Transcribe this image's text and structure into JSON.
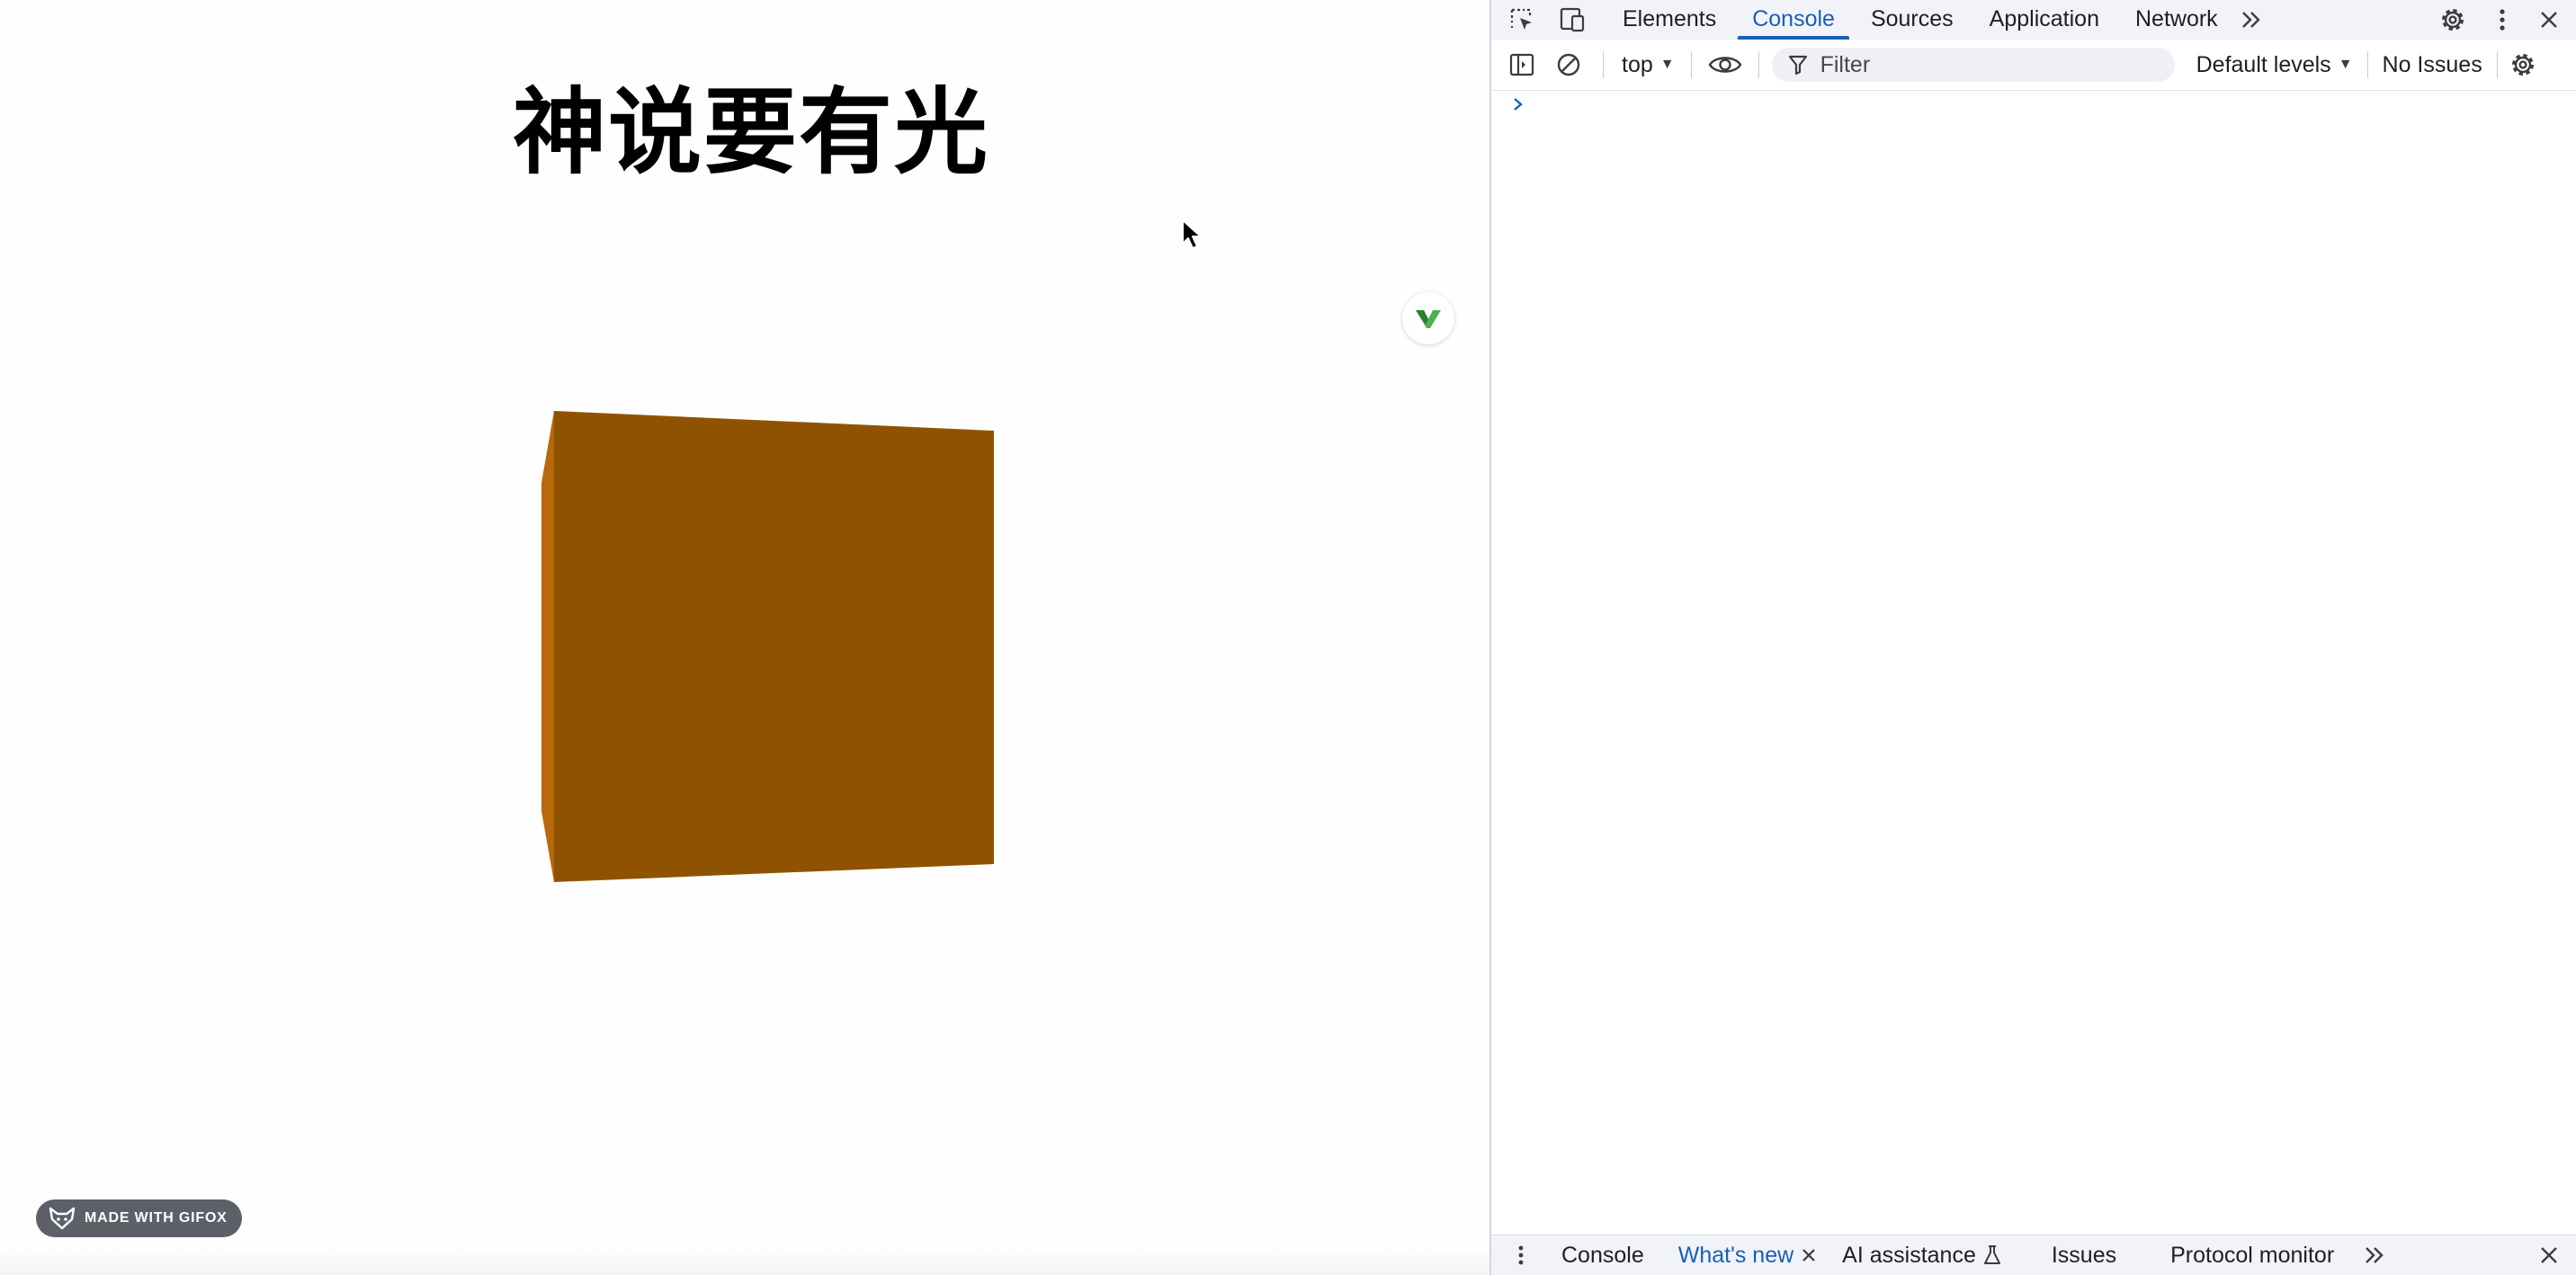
{
  "page": {
    "heading": "神说要有光",
    "badge_icon": "extension-logo-icon",
    "cube_colors": {
      "front": "#8f5300",
      "side": "#b7690c"
    },
    "watermark": "MADE WITH GIFOX"
  },
  "devtools": {
    "tabs": [
      "Elements",
      "Console",
      "Sources",
      "Application",
      "Network"
    ],
    "active_tab": "Console",
    "toolbar": {
      "context": "top",
      "filter_placeholder": "Filter",
      "levels": "Default levels",
      "issues": "No Issues"
    },
    "drawer": {
      "tabs": [
        "Console",
        "What's new",
        "AI assistance",
        "Issues",
        "Protocol monitor"
      ],
      "highlighted": "What's new"
    },
    "accent": "#1a5fb4"
  }
}
